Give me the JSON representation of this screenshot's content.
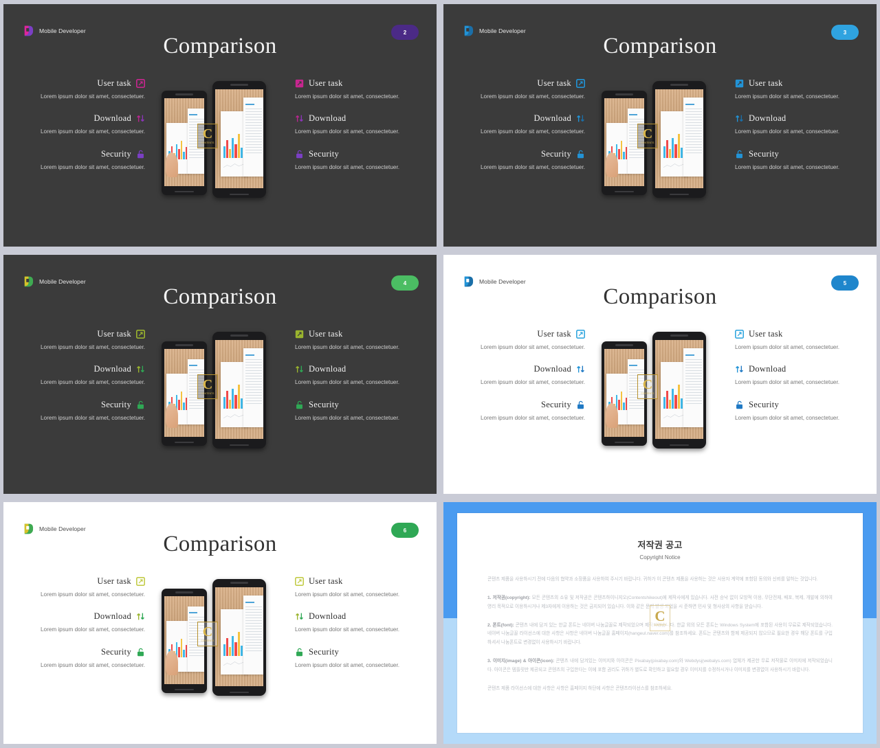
{
  "meta": {
    "gutter_color": "#c9cbd6",
    "dark_slide_bg": "#3b3b3b",
    "light_slide_bg": "#ffffff"
  },
  "common": {
    "brand_name": "Mobile Developer",
    "title": "Comparison",
    "body_text": "Lorem ipsum dolor sit amet, consectetuer.",
    "items": [
      {
        "label": "User task",
        "icon": "external-link-square-icon"
      },
      {
        "label": "Download",
        "icon": "up-down-arrows-icon"
      },
      {
        "label": "Security",
        "icon": "open-lock-icon"
      }
    ],
    "watermark": {
      "letter": "C",
      "caption": "CONTENTS"
    }
  },
  "slides": [
    {
      "theme": "dark",
      "page": "2",
      "accent": "#b8268f",
      "accent2": "#7b3fc4",
      "badge_color": "#4b2a86",
      "logo_a": "#e0259b",
      "logo_b": "#7b3fc4"
    },
    {
      "theme": "dark",
      "page": "3",
      "accent": "#2293d6",
      "accent2": "#2293d6",
      "badge_color": "#2fa3e0",
      "logo_a": "#2293d6",
      "logo_b": "#1b6fa8"
    },
    {
      "theme": "dark",
      "page": "4",
      "accent": "#8fb32b",
      "accent2": "#2eb862",
      "badge_color": "#4bbd63",
      "logo_a": "#d6c22a",
      "logo_b": "#3faa52"
    },
    {
      "theme": "light",
      "page": "5",
      "accent": "#2293d6",
      "accent2": "#1f79c4",
      "badge_color": "#1f86cc",
      "logo_a": "#2293d6",
      "logo_b": "#1b6fa8"
    },
    {
      "theme": "light",
      "page": "6",
      "accent": "#9ab42e",
      "accent2": "#2fa855",
      "badge_color": "#2fa855",
      "logo_a": "#d6c22a",
      "logo_b": "#3faa52"
    }
  ],
  "copyright": {
    "band_top_color": "#4a9bf0",
    "band_bottom_color": "#b4daf9",
    "title": "저작권 공고",
    "subtitle": "Copyright Notice",
    "intro": "콘텐츠 제품을 사용하시기 전에 다음의 협약과 소장품을 사용하여 주시기 바랍니다. 귀하가 이 콘텐츠 제품을 사용하는 것은 사용자 계약에 포함된 동의와 신뢰를 말하는 것입니다.",
    "sections": [
      {
        "heading": "1. 저작권(copyright):",
        "text": "모든 콘텐츠의 소유 및 저작권은 콘텐츠하이니지오(Contentshikeout)에 제작사에게 있습니다. 사전 승낙 없이 모방적 이용, 무단전재, 배포, 복제, 개발에 의하여 영리 목적으로 이용하시거나 제3자에게 이용하는 것은 금지되어 있습니다. 이와 같은 문제 발생 되었을 시 준하면 민사 및 형사상의 사항을 받습니다."
      },
      {
        "heading": "2. 폰트(font):",
        "text": "콘텐츠 내에 담겨 있는 한글 폰트는 네이버 나눔글꼴로 제작되었으며 제작되었습니다. 한글 외의 모든 폰트는 Windows System에 포함된 사용이 무료로 제작되었습니다. 네이버 나눔글꼴 라이선스에 대한 사항은 사항은 네이버 나눔글꼴 홈페이지(hangeul.naver.com)를 참조하세요. 폰트는 콘텐츠와 함께 제공되지 않으므로 필요한 경우 해당 폰트를 구입하셔서 나눔폰트로 변경없이 사용하시기 바랍니다."
      },
      {
        "heading": "3. 이미지(image) & 아이콘(icon):",
        "text": "콘텐츠 내에 담겨있는 이미지와 아이콘은 Pixabay(pixabay.com)와 Webdysj(webalys.com) 업체가 제공한 무료 저작물로 이미지에 저작되었습니다. 아이콘은 템플릿만 제공되고 콘텐츠의 구입한다는 이에 포함 권리도 귀하가 별도로 확인하고 필요할 경우 이미지를 수정하시거나 이미지를 변경없이 사용하시기 바랍니다."
      }
    ],
    "outro": "콘텐츠 제품 라이선스에 대한 사항은 사항은 홈페이지 하단에 사항은 콘텐츠라이선스를 참조하세요.",
    "watermark": {
      "letter": "C",
      "caption": "CONTENTS"
    }
  }
}
